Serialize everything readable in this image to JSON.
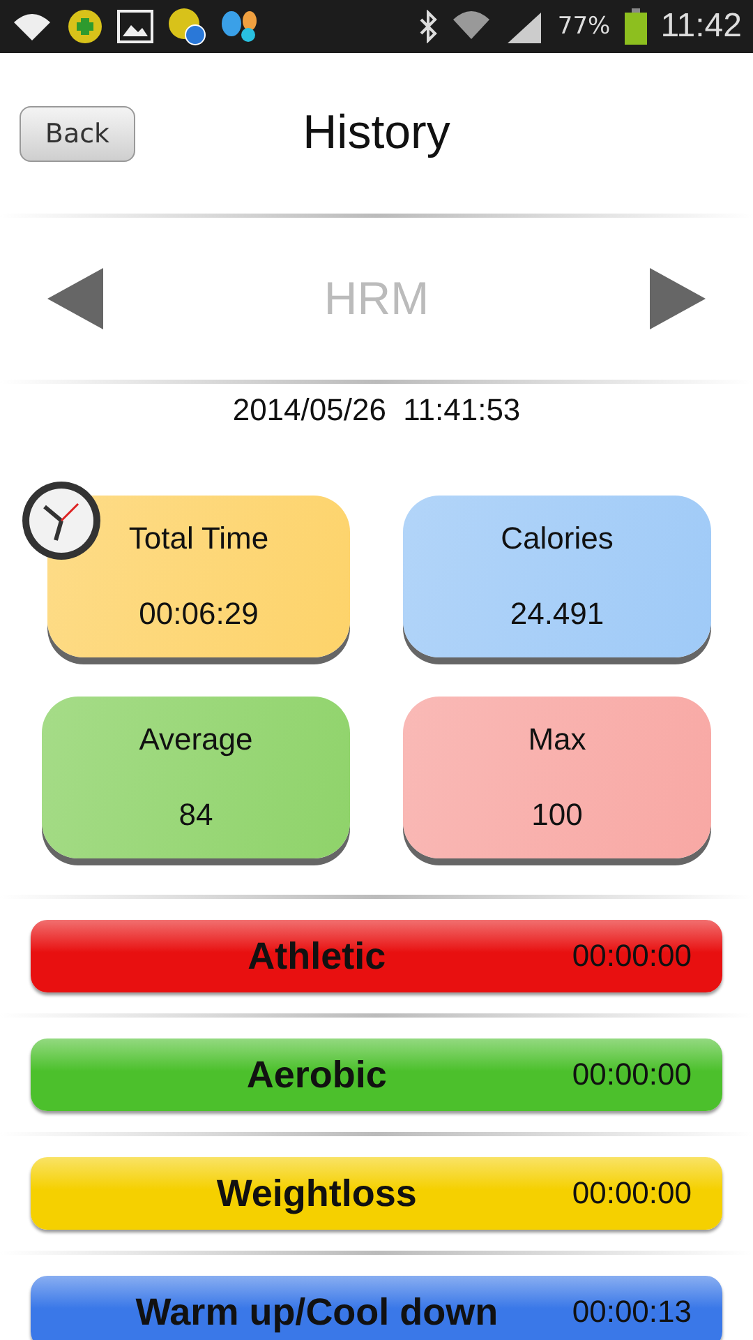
{
  "status_bar": {
    "battery": "77%",
    "time": "11:42"
  },
  "header": {
    "back": "Back",
    "title": "History"
  },
  "nav": {
    "label": "HRM"
  },
  "timestamp": "2014/05/26  11:41:53",
  "stats": [
    {
      "label": "Total Time",
      "value": "00:06:29",
      "color": "#fdd36a",
      "kind": "clock"
    },
    {
      "label": "Calories",
      "value": "24.491",
      "color": "#9fcaf7",
      "kind": "plain"
    },
    {
      "label": "Average",
      "value": "84",
      "color": "#8fd36a",
      "kind": "plain"
    },
    {
      "label": "Max",
      "value": "100",
      "color": "#f8a8a4",
      "kind": "plain"
    }
  ],
  "zones": [
    {
      "name": "Athletic",
      "time": "00:00:00",
      "color": "#e81010"
    },
    {
      "name": "Aerobic",
      "time": "00:00:00",
      "color": "#4cc02c"
    },
    {
      "name": "Weightloss",
      "time": "00:00:00",
      "color": "#f5d000"
    },
    {
      "name": "Warm up/Cool down",
      "time": "00:00:13",
      "color": "#3a78e8"
    }
  ]
}
